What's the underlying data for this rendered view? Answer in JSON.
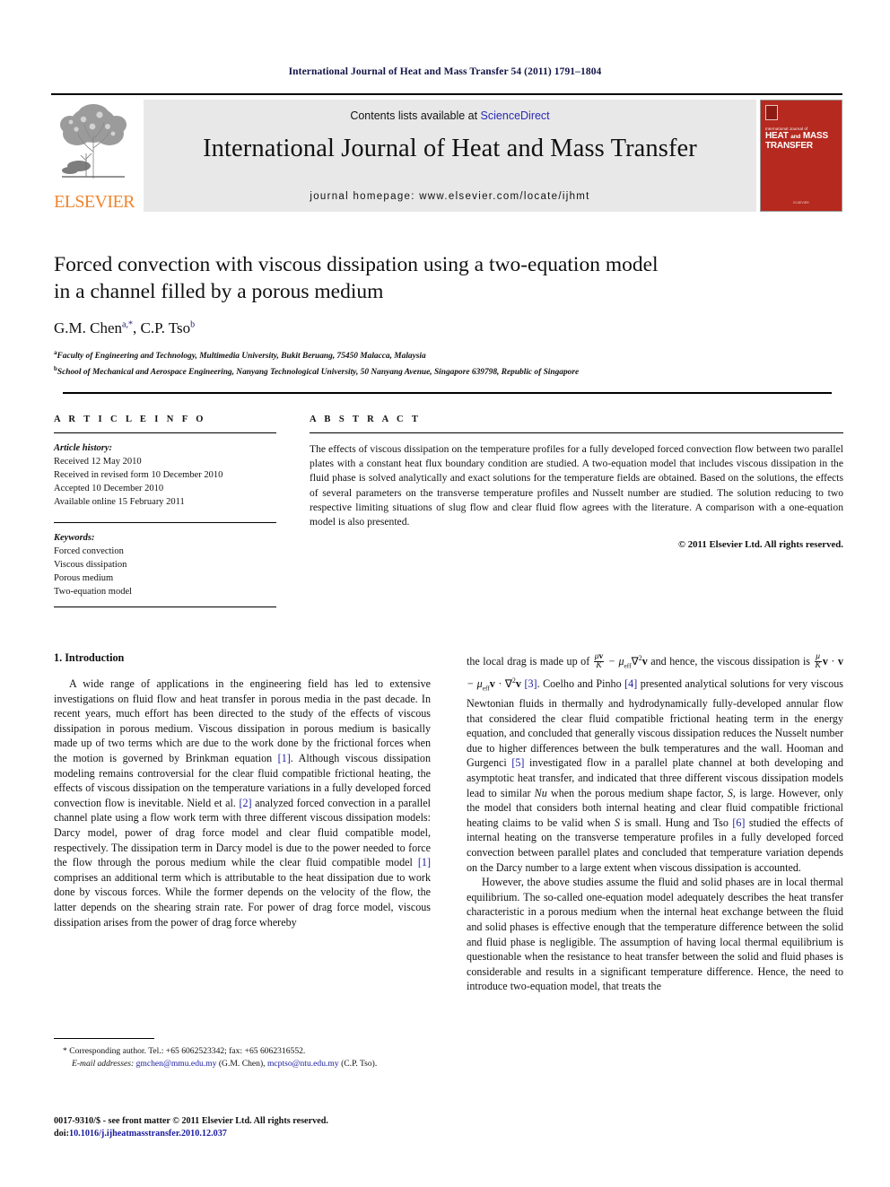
{
  "running_head": "International Journal of Heat and Mass Transfer 54 (2011) 1791–1804",
  "masthead": {
    "contents_prefix": "Contents lists available at ",
    "sciencedirect": "ScienceDirect",
    "journal_title": "International Journal of Heat and Mass Transfer",
    "homepage": "journal homepage: www.elsevier.com/locate/ijhmt",
    "publisher_wordmark": "ELSEVIER",
    "publisher_color": "#f0852c",
    "cover": {
      "small_title": "International Journal of",
      "line1": "HEAT",
      "line1_mid": "and",
      "line1_end": "MASS",
      "line2": "TRANSFER",
      "footer": "ELSEVIER",
      "bg_color": "#b5291f"
    }
  },
  "title": {
    "line1": "Forced convection with viscous dissipation using a two-equation model",
    "line2": "in a channel filled by a porous medium"
  },
  "authors": {
    "name1": "G.M. Chen",
    "sup1": "a,*",
    "sep": ", ",
    "name2": "C.P. Tso",
    "sup2": "b"
  },
  "affiliations": [
    {
      "mark": "a",
      "text": "Faculty of Engineering and Technology, Multimedia University, Bukit Beruang, 75450 Malacca, Malaysia"
    },
    {
      "mark": "b",
      "text": "School of Mechanical and Aerospace Engineering, Nanyang Technological University, 50 Nanyang Avenue, Singapore 639798, Republic of Singapore"
    }
  ],
  "article_info": {
    "heading": "A R T I C L E    I N F O",
    "history_label": "Article history:",
    "history": [
      "Received 12 May 2010",
      "Received in revised form 10 December 2010",
      "Accepted 10 December 2010",
      "Available online 15 February 2011"
    ],
    "keywords_label": "Keywords:",
    "keywords": [
      "Forced convection",
      "Viscous dissipation",
      "Porous medium",
      "Two-equation model"
    ]
  },
  "abstract": {
    "heading": "A B S T R A C T",
    "text": "The effects of viscous dissipation on the temperature profiles for a fully developed forced convection flow between two parallel plates with a constant heat flux boundary condition are studied. A two-equation model that includes viscous dissipation in the fluid phase is solved analytically and exact solutions for the temperature fields are obtained. Based on the solutions, the effects of several parameters on the transverse temperature profiles and Nusselt number are studied. The solution reducing to two respective limiting situations of slug flow and clear fluid flow agrees with the literature. A comparison with a one-equation model is also presented.",
    "copyright": "© 2011 Elsevier Ltd. All rights reserved."
  },
  "body": {
    "section_number_title": "1. Introduction",
    "left_paragraph_part1": "A wide range of applications in the engineering field has led to extensive investigations on fluid flow and heat transfer in porous media in the past decade. In recent years, much effort has been directed to the study of the effects of viscous dissipation in porous medium. Viscous dissipation in porous medium is basically made up of two terms which are due to the work done by the frictional forces when the motion is governed by Brinkman equation ",
    "ref1a": "[1]",
    "left_paragraph_part2": ". Although viscous dissipation modeling remains controversial for the clear fluid compatible frictional heating, the effects of viscous dissipation on the temperature variations in a fully developed forced convection flow is inevitable. Nield et al. ",
    "ref2": "[2]",
    "left_paragraph_part3": " analyzed forced convection in a parallel channel plate using a flow work term with three different viscous dissipation models: Darcy model, power of drag force model and clear fluid compatible model, respectively. The dissipation term in Darcy model is due to the power needed to force the flow through the porous medium while the clear fluid compatible model ",
    "ref1b": "[1]",
    "left_paragraph_part4": " comprises an additional term which is attributable to the heat dissipation due to work done by viscous forces. While the former depends on the velocity of the flow, the latter depends on the shearing strain rate. For power of drag force model, viscous dissipation arises from the power of drag force whereby",
    "right_prefix": "the local drag is made up of ",
    "right_after_formula1": " and hence, the viscous dissipation is ",
    "ref3": "[3]",
    "right_paragraph_part2": ". Coelho and Pinho ",
    "ref4": "[4]",
    "right_paragraph_part3": " presented analytical solutions for very viscous Newtonian fluids in thermally and hydrodynamically fully-developed annular flow that considered the clear fluid compatible frictional heating term in the energy equation, and concluded that generally viscous dissipation reduces the Nusselt number due to higher differences between the bulk temperatures and the wall. Hooman and Gurgenci ",
    "ref5": "[5]",
    "right_paragraph_part4": " investigated flow in a parallel plate channel at both developing and asymptotic heat transfer, and indicated that three different viscous dissipation models lead to similar ",
    "nu_italic": "Nu",
    "right_paragraph_part5": " when the porous medium shape factor, ",
    "s_italic_1": "S",
    "right_paragraph_part6": ", is large. However, only the model that considers both internal heating and clear fluid compatible frictional heating claims to be valid when ",
    "s_italic_2": "S",
    "right_paragraph_part7": " is small. Hung and Tso ",
    "ref6": "[6]",
    "right_paragraph_part8": " studied the effects of internal heating on the transverse temperature profiles in a fully developed forced convection between parallel plates and concluded that temperature variation depends on the Darcy number to a large extent when viscous dissipation is accounted.",
    "right_paragraph2": "However, the above studies assume the fluid and solid phases are in local thermal equilibrium. The so-called one-equation model adequately describes the heat transfer characteristic in a porous medium when the internal heat exchange between the fluid and solid phases is effective enough that the temperature difference between the solid and fluid phase is negligible. The assumption of having local thermal equilibrium is questionable when the resistance to heat transfer between the solid and fluid phases is considerable and results in a significant temperature difference. Hence, the need to introduce two-equation model, that treats the"
  },
  "footnote": {
    "corresponding": "* Corresponding author. Tel.: +65 6062523342; fax: +65 6062316552.",
    "email_label": "E-mail addresses:",
    "email1": "gmchen@mmu.edu.my",
    "email1_owner": " (G.M. Chen), ",
    "email2": "mcptso@ntu.edu.my",
    "email2_owner": " (C.P. Tso)."
  },
  "issn": {
    "line1": "0017-9310/$ - see front matter © 2011 Elsevier Ltd. All rights reserved.",
    "doi_label": "doi:",
    "doi_value": "10.1016/j.ijheatmasstransfer.2010.12.037"
  }
}
